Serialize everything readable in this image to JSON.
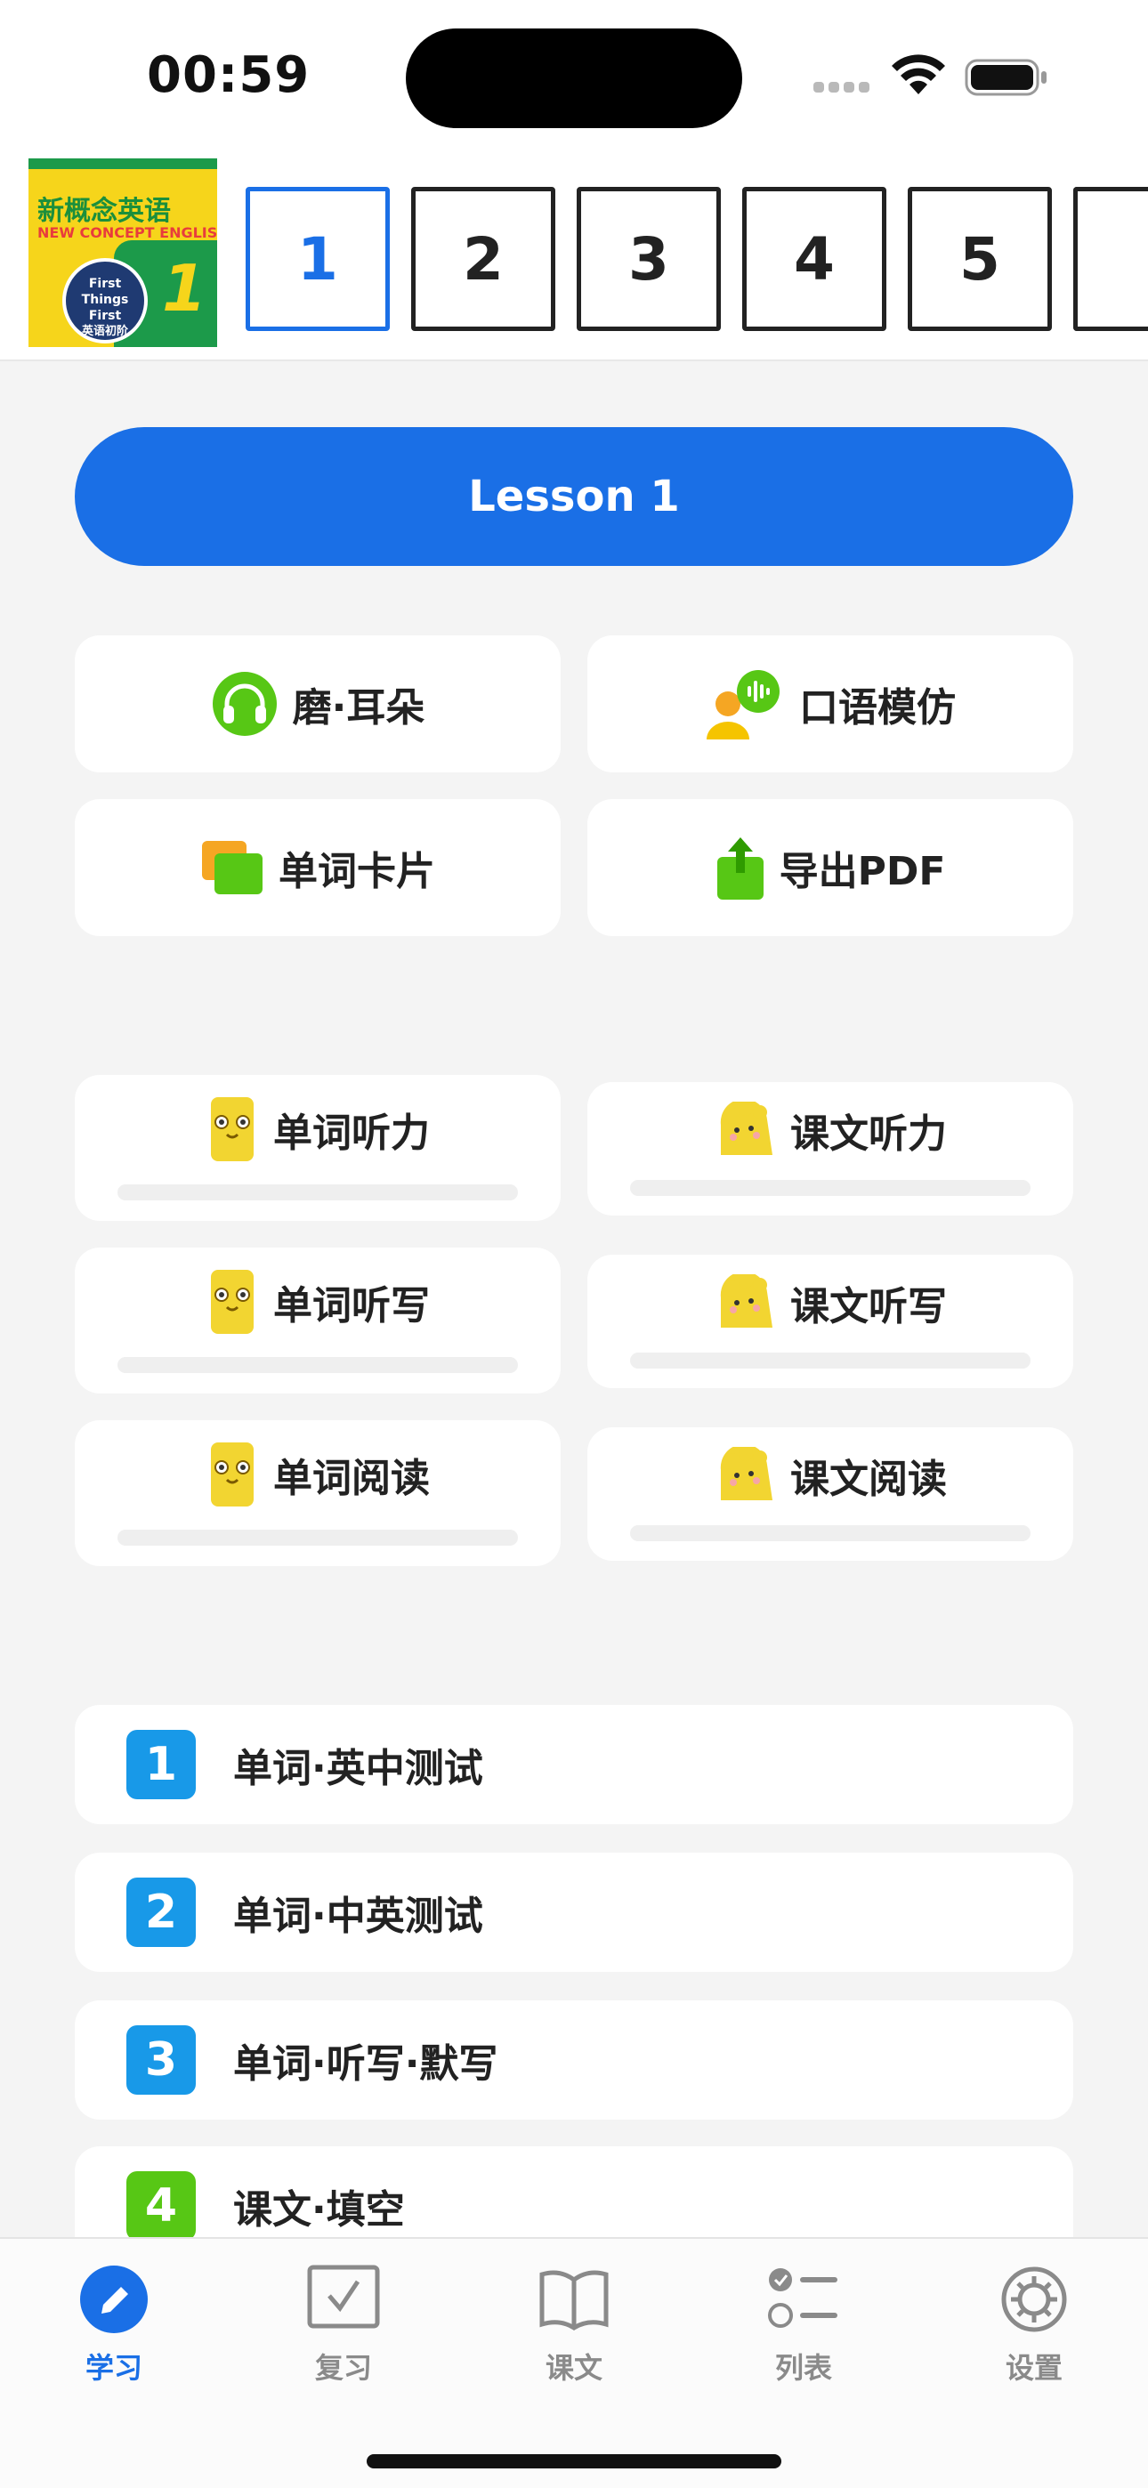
{
  "status": {
    "time": "00:59"
  },
  "book": {
    "title": "新概念英语",
    "subtitle": "NEW CONCEPT ENGLISH",
    "badge_line1": "First",
    "badge_line2": "Things First",
    "badge_line3": "英语初阶",
    "number": "1"
  },
  "lessons": [
    "1",
    "2",
    "3",
    "4",
    "5"
  ],
  "selected_lesson": "1",
  "lesson_button": "Lesson 1",
  "tools": [
    {
      "label": "磨·耳朵",
      "icon": "headphones-icon"
    },
    {
      "label": "口语模仿",
      "icon": "speaking-person-icon"
    },
    {
      "label": "单词卡片",
      "icon": "flashcards-icon"
    },
    {
      "label": "导出PDF",
      "icon": "export-icon"
    }
  ],
  "practice": [
    {
      "label": "单词听力",
      "icon": "yellow-card-mascot-icon"
    },
    {
      "label": "课文听力",
      "icon": "yellow-paw-mascot-icon"
    },
    {
      "label": "单词听写",
      "icon": "yellow-card-mascot-icon"
    },
    {
      "label": "课文听写",
      "icon": "yellow-paw-mascot-icon"
    },
    {
      "label": "单词阅读",
      "icon": "yellow-card-mascot-icon"
    },
    {
      "label": "课文阅读",
      "icon": "yellow-paw-mascot-icon"
    }
  ],
  "quizzes": [
    {
      "num": "1",
      "label": "单词·英中测试"
    },
    {
      "num": "2",
      "label": "单词·中英测试"
    },
    {
      "num": "3",
      "label": "单词·听写·默写"
    },
    {
      "num": "4",
      "label": "课文·填空"
    }
  ],
  "tabs": [
    {
      "label": "学习",
      "icon": "pencil-icon",
      "active": true
    },
    {
      "label": "复习",
      "icon": "checkbox-icon"
    },
    {
      "label": "课文",
      "icon": "book-icon"
    },
    {
      "label": "列表",
      "icon": "checklist-icon"
    },
    {
      "label": "设置",
      "icon": "gear-icon"
    }
  ],
  "colors": {
    "accent": "#1a6fe6",
    "quiz_blue": "#1899e8",
    "quiz_green": "#57c715",
    "mascot_yellow": "#f2d531"
  }
}
